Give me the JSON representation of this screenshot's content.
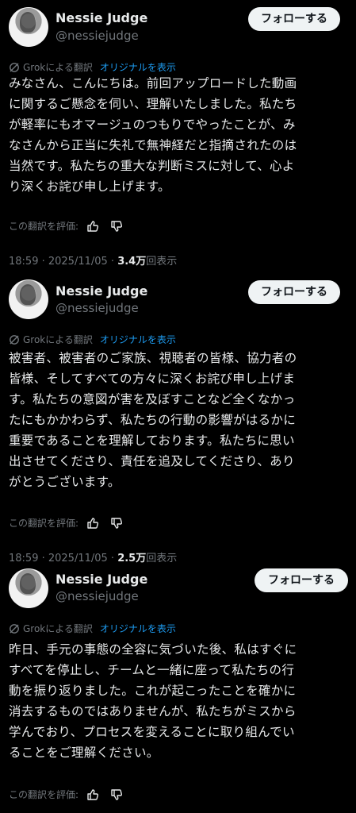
{
  "translate_label": "Grokによる翻訳",
  "show_original": "オリジナルを表示",
  "rate_label": "この翻訳を評価:",
  "follow_label": "フォローする",
  "views_label": "回表示",
  "posts": [
    {
      "name": "Nessie Judge",
      "handle": "@nessiejudge",
      "lines": [
        "みなさん、こんにちは。前回アップロードした動画",
        "に関するご懸念を伺い、理解いたしました。私たち",
        "が軽率にもオマージュのつもりでやったことが、み",
        "なさんから正当に失礼で無神経だと指摘されたのは",
        "当然です。私たちの重大な判断ミスに対して、心よ",
        "り深くお詫び申し上げます。"
      ],
      "timestamp": "18:59 · 2025/11/05 · ",
      "views": "3.4万"
    },
    {
      "name": "Nessie Judge",
      "handle": "@nessiejudge",
      "lines": [
        "被害者、被害者のご家族、視聴者の皆様、協力者の",
        "皆様、そしてすべての方々に深くお詫び申し上げま",
        "す。私たちの意図が害を及ぼすことなど全くなかっ",
        "たにもかかわらず、私たちの行動の影響がはるかに",
        "重要であることを理解しております。私たちに思い",
        "出させてくださり、責任を追及してくださり、あり",
        "がとうございます。"
      ],
      "timestamp": "18:59 · 2025/11/05 · ",
      "views": "2.5万"
    },
    {
      "name": "Nessie Judge",
      "handle": "@nessiejudge",
      "lines": [
        "昨日、手元の事態の全容に気づいた後、私はすぐに",
        "すべてを停止し、チームと一緒に座って私たちの行",
        "動を振り返りました。これが起こったことを確かに",
        "消去するものではありませんが、私たちがミスから",
        "学んでおり、プロセスを変えることに取り組んでい",
        "ることをご理解ください。"
      ]
    }
  ]
}
